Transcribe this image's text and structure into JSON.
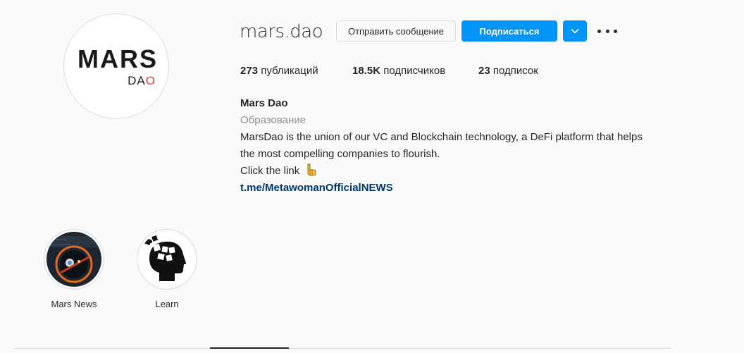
{
  "profile": {
    "username": "mars.dao",
    "logo_text_main": "MARS",
    "logo_text_sub_prefix": "DA",
    "logo_text_sub_accent": "O",
    "avatar_icon": "mars-dao-logo"
  },
  "actions": {
    "message_label": "Отправить сообщение",
    "follow_label": "Подписаться",
    "dropdown_icon": "chevron-down-icon",
    "more_icon": "more-horizontal-icon"
  },
  "stats": {
    "posts_count": "273",
    "posts_label": "публикаций",
    "followers_count": "18.5K",
    "followers_label": "подписчиков",
    "following_count": "23",
    "following_label": "подписок"
  },
  "bio": {
    "full_name": "Mars Dao",
    "category": "Образование",
    "description_line1": "MarsDao is the union of our VC and Blockchain technology, a DeFi platform that helps",
    "description_line2": "the most compelling companies to flourish.",
    "cta": "Click the link",
    "cta_icon": "pointing-down-hand-icon",
    "link": "t.me/MetawomanOfficialNEWS"
  },
  "highlights": [
    {
      "label": "Mars News",
      "icon": "mars-news-cover"
    },
    {
      "label": "Learn",
      "icon": "head-puzzle-cover"
    }
  ],
  "colors": {
    "background": "#fafafa",
    "accent_blue": "#0095f6",
    "link_blue": "#00376b",
    "muted_text": "#8e8e8e",
    "logo_red": "#e53935"
  }
}
